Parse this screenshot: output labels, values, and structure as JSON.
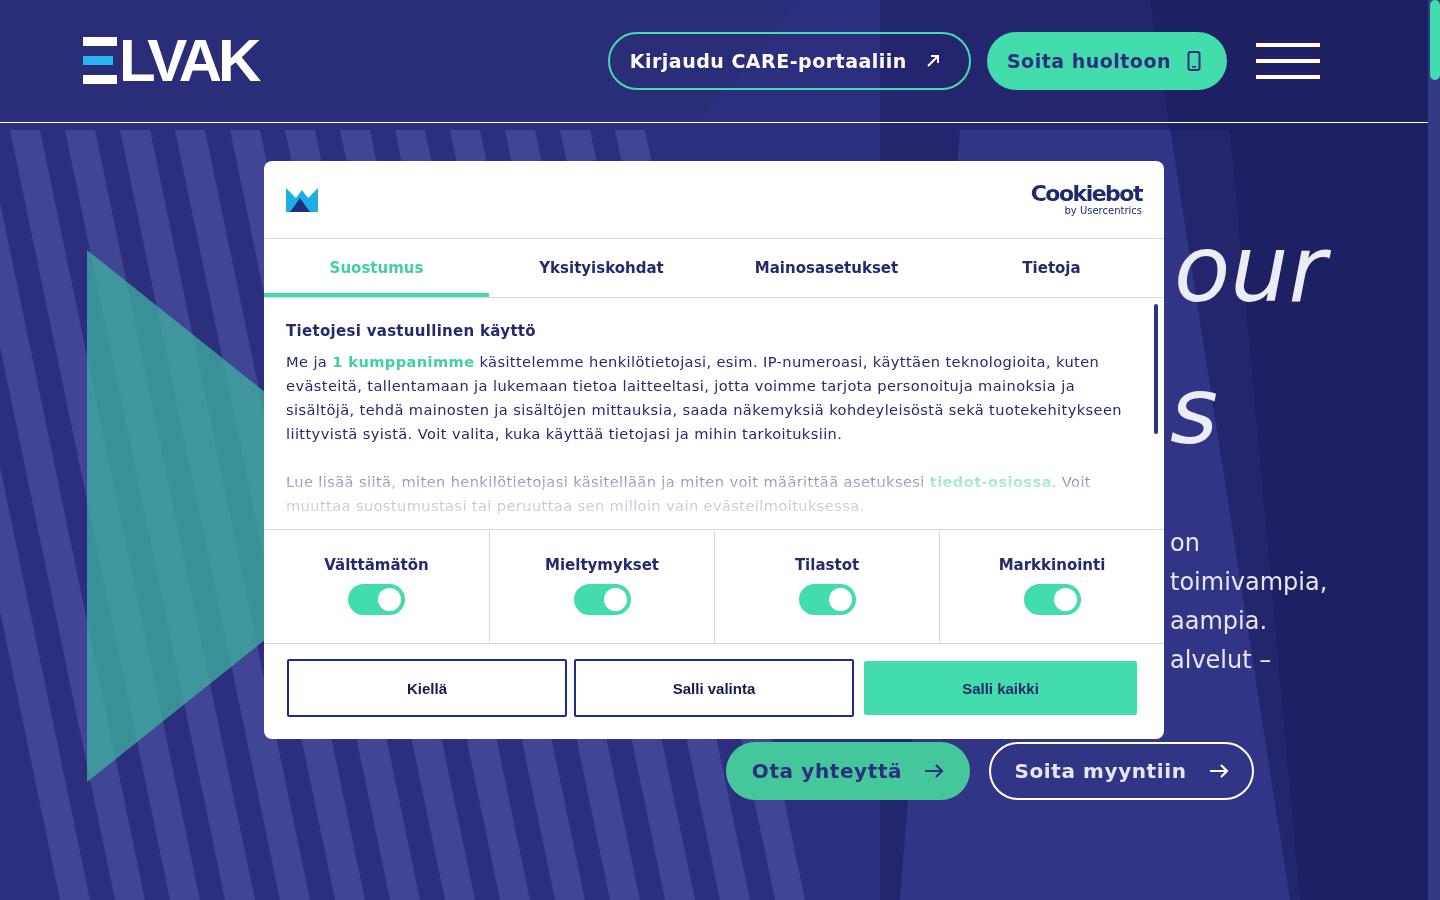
{
  "header": {
    "logo_text": "LVAK",
    "login_button": "Kirjaudu CARE-portaaliin",
    "call_button": "Soita huoltoon"
  },
  "hero": {
    "title_fragments": [
      "our",
      "s"
    ],
    "text_fragments": [
      "on",
      "toimivampia,",
      "aampia.",
      "alvelut –"
    ],
    "buttons": [
      {
        "label": "Ota yhteyttä",
        "kind": "primary"
      },
      {
        "label": "Soita myyntiin",
        "kind": "outline"
      }
    ]
  },
  "consent": {
    "brand_name": "Cookiebot",
    "brand_sub": "by Usercentrics",
    "tabs": [
      {
        "label": "Suostumus",
        "selected": true
      },
      {
        "label": "Yksityiskohdat",
        "selected": false
      },
      {
        "label": "Mainosasetukset",
        "selected": false
      },
      {
        "label": "Tietoja",
        "selected": false
      }
    ],
    "heading": "Tietojesi vastuullinen käyttö",
    "paragraphs": [
      {
        "before": "Me ja ",
        "link": "1 kumppanimme",
        "after": " käsittelemme henkilötietojasi, esim. IP-numeroasi, käyttäen teknologioita, kuten evästeitä, tallentamaan ja lukemaan tietoa laitteeltasi, jotta voimme tarjota personoituja mainoksia ja sisältöjä, tehdä mainosten ja sisältöjen mittauksia, saada näkemyksiä kohdeyleisöstä sekä tuotekehitykseen liittyvistä syistä. Voit valita, kuka käyttää tietojasi ja mihin tarkoituksiin."
      },
      {
        "before": "Lue lisää siitä, miten henkilötietojasi käsitellään ja miten voit määrittää asetuksesi ",
        "link": "tiedot-osiossa",
        "after": ". Voit muuttaa suostumustasi tai peruuttaa sen milloin vain evästeilmoituksessa."
      }
    ],
    "categories": [
      {
        "label": "Välttämätön",
        "on": true
      },
      {
        "label": "Mieltymykset",
        "on": true
      },
      {
        "label": "Tilastot",
        "on": true
      },
      {
        "label": "Markkinointi",
        "on": true
      }
    ],
    "buttons": [
      {
        "label": "Kiellä",
        "kind": "outline"
      },
      {
        "label": "Salli valinta",
        "kind": "outline"
      },
      {
        "label": "Salli kaikki",
        "kind": "primary"
      }
    ]
  }
}
